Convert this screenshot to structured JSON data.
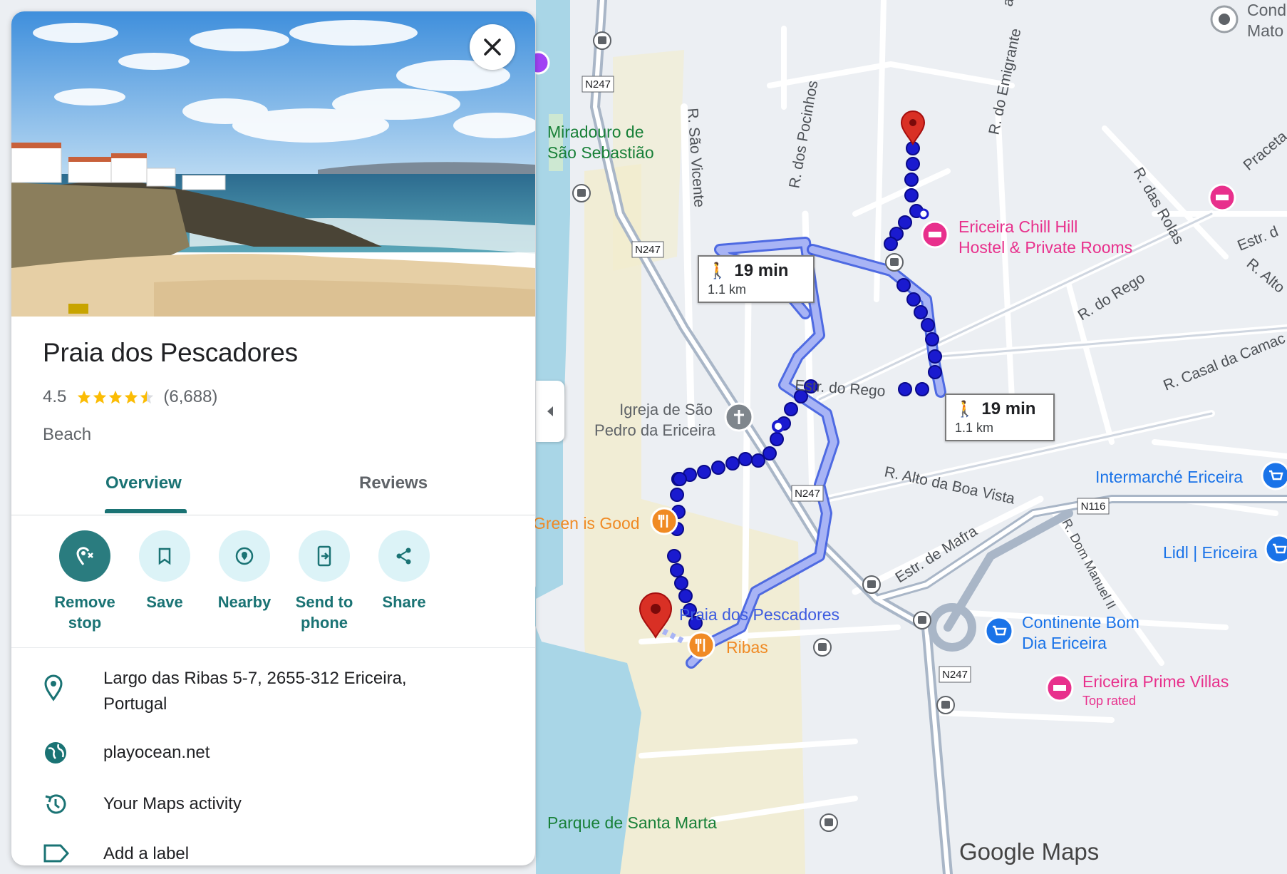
{
  "place": {
    "name": "Praia dos Pescadores",
    "rating": "4.5",
    "rating_value": 4.5,
    "review_count": "(6,688)",
    "category": "Beach"
  },
  "tabs": {
    "overview": "Overview",
    "reviews": "Reviews"
  },
  "actions": {
    "remove_stop": "Remove stop",
    "save": "Save",
    "nearby": "Nearby",
    "send_to_phone": "Send to phone",
    "share": "Share"
  },
  "details": {
    "address": "Largo das Ribas 5-7, 2655-312 Ericeira, Portugal",
    "website": "playocean.net",
    "activity": "Your Maps activity",
    "label": "Add a label"
  },
  "route_bubbles": [
    {
      "time": "19 min",
      "distance": "1.1 km"
    },
    {
      "time": "19 min",
      "distance": "1.1 km"
    }
  ],
  "map_labels": {
    "cond_mato": [
      "Cond",
      "Mato"
    ],
    "miradouro": [
      "Miradouro de",
      "São Sebastião"
    ],
    "r_sao_vicente": "R. São Vicente",
    "r_pocinhos": "R. dos Pocinhos",
    "r_emigrante": "R. do Emigrante",
    "ar_fragment": "ar",
    "hostel": [
      "Ericeira Chill Hill",
      "Hostel & Private Rooms"
    ],
    "r_rolas": "R. das Rolas",
    "praceta": "Praceta",
    "estr_d": "Estr. d",
    "r_alto": "R. Alto",
    "r_rego": "R. do Rego",
    "r_casal": "R. Casal da Camac",
    "estr_rego": "Estr. do Rego",
    "igreja": [
      "Igreja de São",
      "Pedro da Ericeira"
    ],
    "r_alto_boa_vista": "R. Alto da Boa Vista",
    "intermarche": "Intermarché Ericeira",
    "green_is_good": "Green is Good",
    "estr_mafra": "Estr. de Mafra",
    "r_dom_manuel": "R. Dom Manuel II",
    "lidl": "Lidl | Ericeira",
    "praia_label": "Praia dos Pescadores",
    "ribas": "Ribas",
    "continente": [
      "Continente Bom",
      "Dia Ericeira"
    ],
    "prime_villas": "Ericeira Prime Villas",
    "top_rated": "Top rated",
    "parque": "Parque de Santa Marta",
    "shields": [
      "N247",
      "N247",
      "N247",
      "N247",
      "N116"
    ]
  },
  "brand": {
    "google": "Google",
    "maps": "Maps"
  },
  "colors": {
    "teal": "#1a7374",
    "route": "#1a1acf",
    "route_alt": "#a8b4f5",
    "water": "#a9d6e7",
    "pin": "#d93025",
    "hotel": "#e8308c",
    "food": "#f08a24",
    "shop": "#1a73e8",
    "park_text": "#188038"
  }
}
